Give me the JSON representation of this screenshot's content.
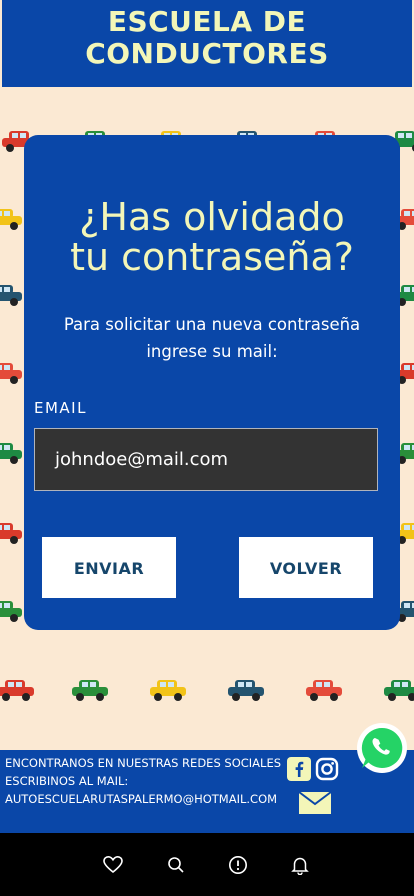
{
  "header": {
    "title_line1": "ESCUELA DE",
    "title_line2": "CONDUCTORES"
  },
  "card": {
    "heading_line1": "¿Has olvidado",
    "heading_line2": "tu contraseña?",
    "subtitle": "Para solicitar una nueva contraseña ingrese su mail:",
    "email_label": "EMAIL",
    "email_value": "johndoe@mail.com",
    "send_label": "ENVIAR",
    "back_label": "VOLVER"
  },
  "footer": {
    "social_text": "ENCONTRANOS EN NUESTRAS REDES SOCIALES",
    "mail_prompt": " ESCRIBINOS AL MAIL:",
    "mail_address": "AUTOESCUELARUTASPALERMO@HOTMAIL.COM"
  },
  "icons": {
    "facebook": "facebook-icon",
    "instagram": "instagram-icon",
    "mail": "mail-icon",
    "whatsapp": "whatsapp-icon",
    "nav": [
      "heart-icon",
      "search-icon",
      "info-icon",
      "bell-icon"
    ]
  },
  "colors": {
    "brand_blue": "#0a47a8",
    "title_yellow": "#f3f6b8",
    "background": "#fbe9d3",
    "input_bg": "#333333",
    "button_text": "#16466b",
    "whatsapp_green": "#25d366"
  }
}
